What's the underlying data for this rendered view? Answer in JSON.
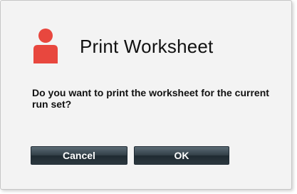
{
  "dialog": {
    "title": "Print Worksheet",
    "icon": "user-icon",
    "message": "Do you want to print the worksheet for the current run set?",
    "buttons": {
      "cancel_label": "Cancel",
      "ok_label": "OK"
    }
  },
  "colors": {
    "icon": "#e8473e",
    "button": "#2c383f",
    "background": "#f3f3f3"
  }
}
